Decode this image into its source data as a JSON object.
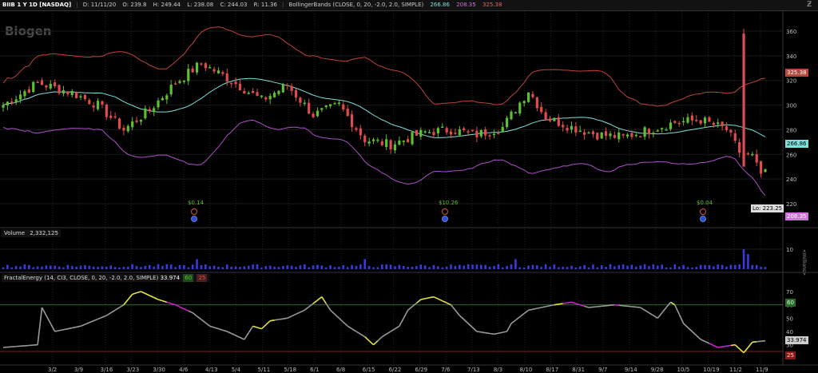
{
  "header": {
    "symbol": "BIIB 1 Y 1D [NASDAQ]",
    "date": "D: 11/11/20",
    "open": "O: 239.8",
    "high": "H: 249.44",
    "low": "L: 238.08",
    "close": "C: 244.03",
    "range": "R: 11.36",
    "study": "BollingerBands (CLOSE, 0, 20, -2.0, 2.0, SIMPLE)",
    "bb_mid": "266.86",
    "bb_low": "208.35",
    "bb_up": "325.38"
  },
  "logo_text": "Biogen",
  "price_axis": {
    "ticks": [
      "360",
      "340",
      "320",
      "300",
      "280",
      "260",
      "240",
      "220"
    ]
  },
  "price_tags": {
    "upper": "325.38",
    "mid": "266.86",
    "lower": "208.35"
  },
  "lo_label": "Lo: 223.25",
  "dividend_labels": [
    "$0.14",
    "$10.26",
    "$0.04"
  ],
  "volume": {
    "label": "Volume",
    "value": "2,332,125",
    "axis_tick": "10",
    "units": "<millions>"
  },
  "fe": {
    "label": "FractalEnergy (14, CI3, CLOSE, 0, 20, -2.0, 2.0, SIMPLE)",
    "value": "33.974",
    "mini1": "60",
    "mini2": "25",
    "ticks": [
      "70",
      "60",
      "50",
      "40",
      "30"
    ],
    "tag60": "60",
    "tag_val": "33.974",
    "tag25": "25"
  },
  "x_labels": [
    "3/2",
    "3/9",
    "3/16",
    "3/23",
    "3/30",
    "4/6",
    "4/13",
    "5/4",
    "5/11",
    "5/18",
    "6/1",
    "6/8",
    "6/15",
    "6/22",
    "6/29",
    "7/6",
    "7/13",
    "8/3",
    "8/10",
    "8/17",
    "8/31",
    "9/7",
    "9/14",
    "9/28",
    "10/5",
    "10/19",
    "11/2",
    "11/9"
  ],
  "colors": {
    "up": "#5fbf2f",
    "down": "#e24b4b",
    "bb_mid": "#7ee0dc",
    "bb_low": "#b04fc8",
    "bb_up": "#c0423c",
    "volume": "#3a3ae0",
    "fe_gray": "#9a9a9a",
    "fe_yellow": "#e6e640",
    "fe_magenta": "#d020d0"
  }
}
